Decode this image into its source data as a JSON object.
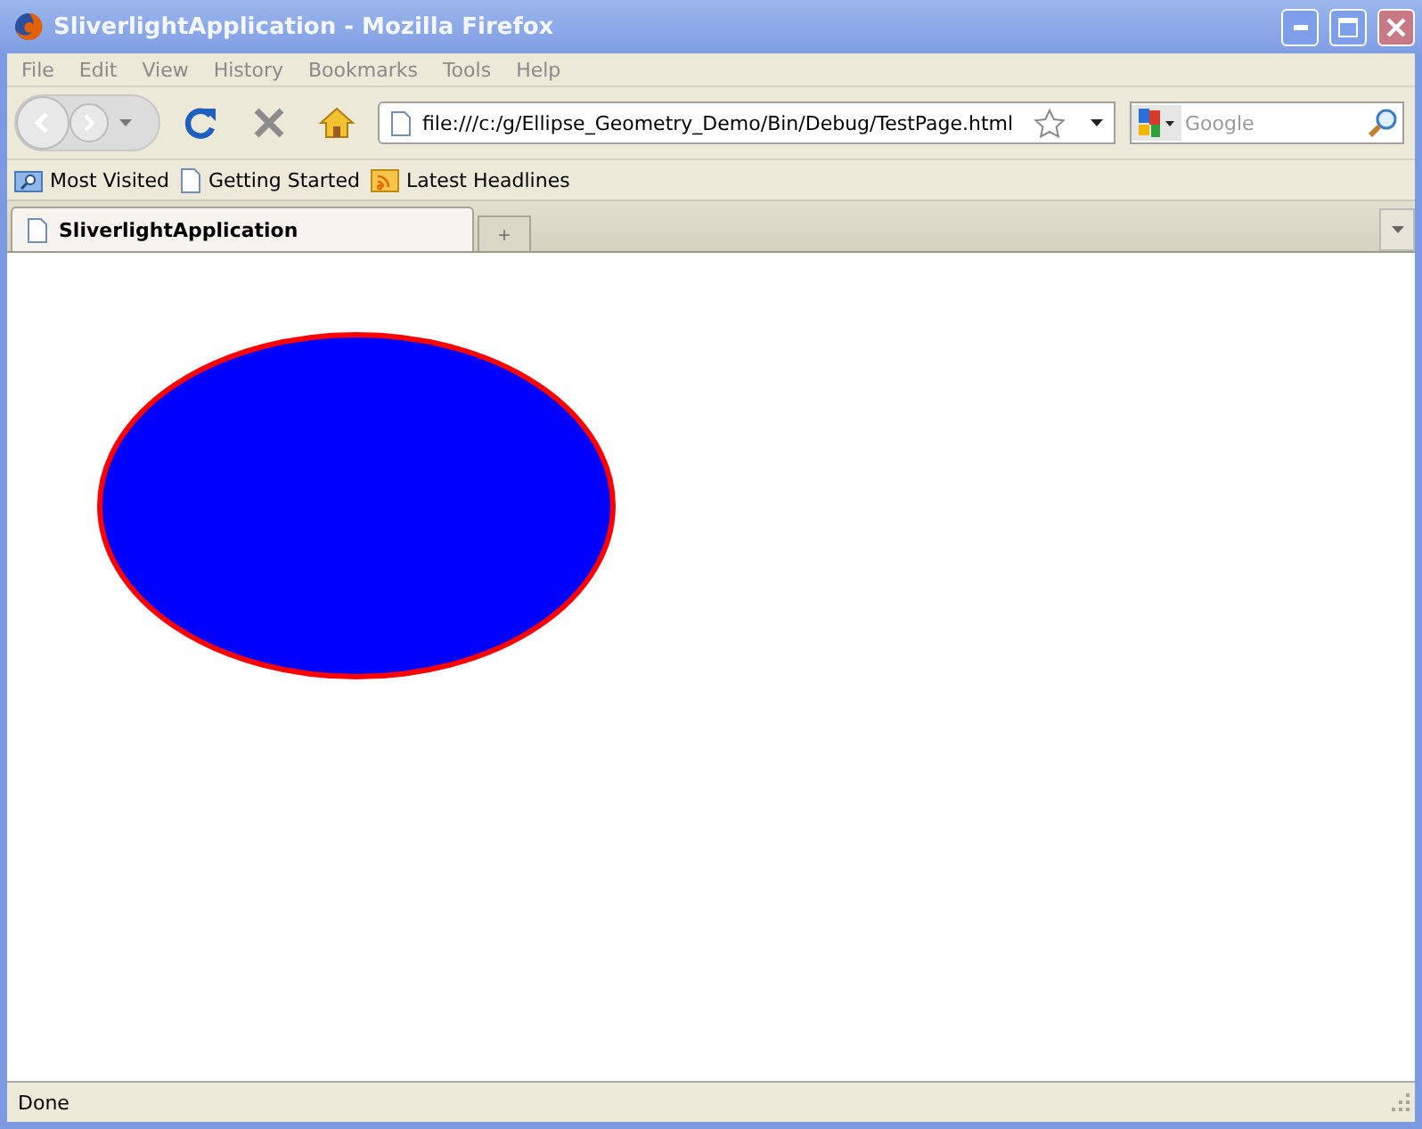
{
  "window": {
    "title": "SliverlightApplication - Mozilla Firefox"
  },
  "menu": [
    "File",
    "Edit",
    "View",
    "History",
    "Bookmarks",
    "Tools",
    "Help"
  ],
  "address": {
    "value": "file:///c:/g/Ellipse_Geometry_Demo/Bin/Debug/TestPage.html"
  },
  "search": {
    "placeholder": "Google"
  },
  "bookmarks": [
    "Most Visited",
    "Getting Started",
    "Latest Headlines"
  ],
  "tabs": [
    {
      "label": "SliverlightApplication",
      "selected": true
    }
  ],
  "new_tab": "+",
  "status_bar": {
    "text": "Done"
  }
}
